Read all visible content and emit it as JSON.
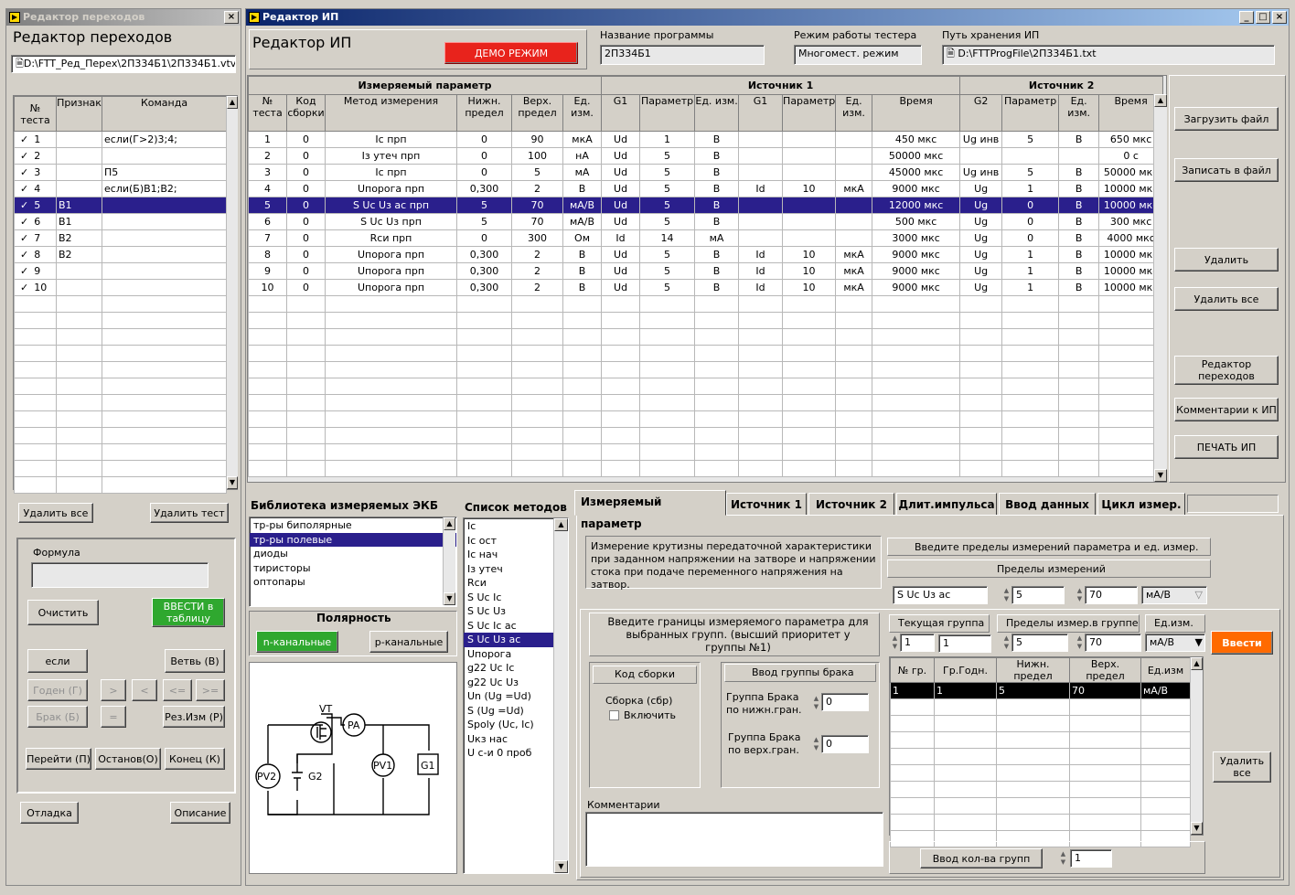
{
  "left_window": {
    "title": "Редактор переходов",
    "heading": "Редактор переходов",
    "path": "D:\\FTT_Ред_Перех\\2П334Б1\\2П334Б1.vtv",
    "columns": [
      "№ теста",
      "Признак",
      "Команда"
    ],
    "rows": [
      {
        "check": "✓",
        "num": "1",
        "sign": "",
        "cmd": "если(Г>2)3;4;"
      },
      {
        "check": "✓",
        "num": "2",
        "sign": "",
        "cmd": ""
      },
      {
        "check": "✓",
        "num": "3",
        "sign": "",
        "cmd": "П5"
      },
      {
        "check": "✓",
        "num": "4",
        "sign": "",
        "cmd": "если(Б)В1;В2;"
      },
      {
        "check": "✓",
        "num": "5",
        "sign": "В1",
        "cmd": ""
      },
      {
        "check": "✓",
        "num": "6",
        "sign": "В1",
        "cmd": ""
      },
      {
        "check": "✓",
        "num": "7",
        "sign": "В2",
        "cmd": ""
      },
      {
        "check": "✓",
        "num": "8",
        "sign": "В2",
        "cmd": ""
      },
      {
        "check": "✓",
        "num": "9",
        "sign": "",
        "cmd": ""
      },
      {
        "check": "✓",
        "num": "10",
        "sign": "",
        "cmd": ""
      }
    ],
    "delete_all": "Удалить все",
    "delete_test": "Удалить тест",
    "formula_label": "Формула",
    "clear": "Очистить",
    "enter_table": "ВВЕСТИ в таблицу",
    "if_btn": "если",
    "branch": "Ветвь (В)",
    "good": "Годен (Г)",
    "gt": ">",
    "lt": "<",
    "le": "<=",
    "ge": ">=",
    "defect": "Брак (Б)",
    "eq": "=",
    "res": "Рез.Изм (Р)",
    "goto": "Перейти (П)",
    "stop": "Останов(О)",
    "end": "Конец (К)",
    "debug": "Отладка",
    "desc": "Описание"
  },
  "main_window": {
    "title": "Редактор ИП",
    "heading": "Редактор ИП",
    "demo": "ДЕМО РЕЖИМ",
    "prog_label": "Название программы",
    "prog_value": "2П334Б1",
    "mode_label": "Режим работы тестера",
    "mode_value": "Многомест. режим",
    "path_label": "Путь хранения ИП",
    "path_value": "D:\\FTTProgFile\\2П334Б1.txt",
    "groups": [
      "Измеряемый параметр",
      "Источник 1",
      "Источник 2"
    ],
    "columns": [
      "№ теста",
      "Код сборки",
      "Метод измерения",
      "Нижн. предел",
      "Верх. предел",
      "Ед. изм.",
      "G1",
      "Параметр",
      "Ед. изм.",
      "G1",
      "Параметр",
      "Ед. изм.",
      "Время",
      "G2",
      "Параметр",
      "Ед. изм.",
      "Время"
    ],
    "rows": [
      [
        "1",
        "0",
        "Ic прп",
        "0",
        "90",
        "мкА",
        "Ud",
        "1",
        "В",
        "",
        "",
        "",
        "450 мкс",
        "Ug инв",
        "5",
        "В",
        "650 мкс"
      ],
      [
        "2",
        "0",
        "Iз утеч прп",
        "0",
        "100",
        "нА",
        "Ud",
        "5",
        "В",
        "",
        "",
        "",
        "50000 мкс",
        "",
        "",
        "",
        "0 с"
      ],
      [
        "3",
        "0",
        "Ic прп",
        "0",
        "5",
        "мА",
        "Ud",
        "5",
        "В",
        "",
        "",
        "",
        "45000 мкс",
        "Ug инв",
        "5",
        "В",
        "50000 мкс"
      ],
      [
        "4",
        "0",
        "Uпорога прп",
        "0,300",
        "2",
        "В",
        "Ud",
        "5",
        "В",
        "Id",
        "10",
        "мкА",
        "9000 мкс",
        "Ug",
        "1",
        "В",
        "10000 мкс"
      ],
      [
        "5",
        "0",
        "S Uc Uз ac прп",
        "5",
        "70",
        "мА/В",
        "Ud",
        "5",
        "В",
        "",
        "",
        "",
        "12000 мкс",
        "Ug",
        "0",
        "В",
        "10000 мкс"
      ],
      [
        "6",
        "0",
        "S Uc Uз прп",
        "5",
        "70",
        "мА/В",
        "Ud",
        "5",
        "В",
        "",
        "",
        "",
        "500 мкс",
        "Ug",
        "0",
        "В",
        "300 мкс"
      ],
      [
        "7",
        "0",
        "Rси прп",
        "0",
        "300",
        "Ом",
        "Id",
        "14",
        "мА",
        "",
        "",
        "",
        "3000 мкс",
        "Ug",
        "0",
        "В",
        "4000 мкс"
      ],
      [
        "8",
        "0",
        "Uпорога прп",
        "0,300",
        "2",
        "В",
        "Ud",
        "5",
        "В",
        "Id",
        "10",
        "мкА",
        "9000 мкс",
        "Ug",
        "1",
        "В",
        "10000 мкс"
      ],
      [
        "9",
        "0",
        "Uпорога прп",
        "0,300",
        "2",
        "В",
        "Ud",
        "5",
        "В",
        "Id",
        "10",
        "мкА",
        "9000 мкс",
        "Ug",
        "1",
        "В",
        "10000 мкс"
      ],
      [
        "10",
        "0",
        "Uпорога прп",
        "0,300",
        "2",
        "В",
        "Ud",
        "5",
        "В",
        "Id",
        "10",
        "мкА",
        "9000 мкс",
        "Ug",
        "1",
        "В",
        "10000 мкс"
      ]
    ],
    "btn_load": "Загрузить файл",
    "btn_save": "Записать в файл",
    "btn_delete": "Удалить",
    "btn_delete_all": "Удалить все",
    "btn_trans": "Редактор переходов",
    "btn_comments": "Комментарии к ИП",
    "btn_print": "ПЕЧАТЬ ИП",
    "lib_title": "Библиотека измеряемых ЭКБ",
    "lib_items": [
      "тр-ры биполярные",
      "тр-ры полевые",
      "диоды",
      "тиристоры",
      "оптопары"
    ],
    "polarity_title": "Полярность",
    "pol_n": "n-канальные",
    "pol_p": "p-канальные",
    "methods_title": "Список методов",
    "methods": [
      "Ic",
      "Ic ост",
      "Ic нач",
      "Iз утеч",
      "Rси",
      "S Uc Ic",
      "S Uc Uз",
      "S Uc Ic ac",
      "S Uc Uз ac",
      "Uпорога",
      "g22 Uc Ic",
      "g22 Uc Uз",
      "Un (Ug =Ud)",
      "S (Ug =Ud)",
      "Spoly (Uc, Ic)",
      "Uкз нас",
      "U с-и 0 проб"
    ],
    "circuit": {
      "vt": "VT",
      "pa": "PA",
      "pv1": "PV1",
      "pv2": "PV2",
      "g1": "G1",
      "g2": "G2"
    },
    "tabs": [
      "Измеряемый параметр",
      "Источник 1",
      "Источник 2",
      "Длит.импульса",
      "Ввод данных",
      "Цикл измер."
    ],
    "description": "Измерение крутизны передаточной   характеристики при заданном напряжении на затворе и напряжении стока при подаче переменного напряжения на затвор.",
    "limits_prompt": "Введите пределы измерений параметра и ед. измер.",
    "limits_label": "Пределы измерений",
    "limits_method": "S Uc Uз ac",
    "limits_low": "5",
    "limits_high": "70",
    "limits_unit": "мА/В",
    "groups_prompt": "Введите границы измеряемого параметра для выбранных групп. (высший приоритет у группы №1)",
    "code_title": "Код сборки",
    "assembly": "Сборка (сбр)",
    "enable": "Включить",
    "defect_title": "Ввод группы брака",
    "defect_low": "Группа Брака по нижн.гран.",
    "defect_low_val": "0",
    "defect_high": "Группа Брака по верх.гран.",
    "defect_high_val": "0",
    "current_group": "Текущая группа",
    "cg_val1": "1",
    "cg_val2": "1",
    "group_limits": "Пределы измер.в группе",
    "gl_low": "5",
    "gl_high": "70",
    "unit_label": "Ед.изм.",
    "unit_val": "мА/В",
    "enter": "Ввести",
    "gtable_cols": [
      "№ гр.",
      "Гр.Годн.",
      "Нижн. предел",
      "Верх. предел",
      "Ед.изм"
    ],
    "gtable_rows": [
      [
        "1",
        "1",
        "5",
        "70",
        "мА/В"
      ]
    ],
    "delete_all2": "Удалить все",
    "comments": "Комментарии",
    "groups_count_btn": "Ввод кол-ва групп",
    "groups_count": "1"
  }
}
